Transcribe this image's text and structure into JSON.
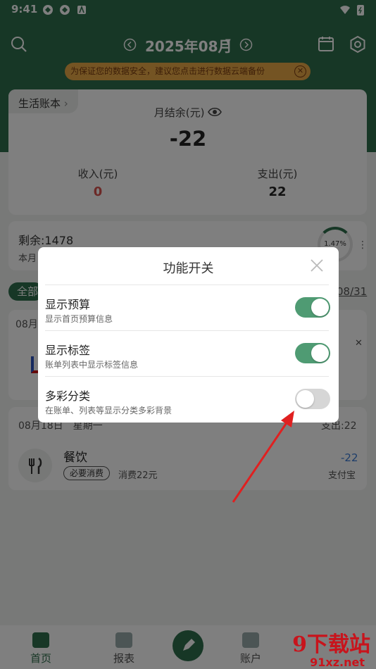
{
  "status_bar": {
    "time": "9:41"
  },
  "header": {
    "month": "2025年08月",
    "banner": "为保证您的数据安全，建议您点击进行数据云端备份"
  },
  "summary": {
    "book_name": "生活账本",
    "balance_label": "月结余(元)",
    "balance_value": "-22",
    "income_label": "收入(元)",
    "income_value": "0",
    "expense_label": "支出(元)",
    "expense_value": "22"
  },
  "budget": {
    "remain_label": "剩余:",
    "remain_value": "1478",
    "month_prefix": "本月",
    "percent": "1.47%"
  },
  "list": {
    "filter_all": "全部",
    "date_right": "08/31",
    "group_date_prefix": "08月",
    "record_date": "08月18日",
    "weekday": "星期一",
    "record_expense": "支出:22",
    "category": "餐饮",
    "tag": "必要消费",
    "note": "消费22元",
    "amount": "-22",
    "account": "支付宝"
  },
  "dialog": {
    "title": "功能开关",
    "rows": [
      {
        "title": "显示预算",
        "subtitle": "显示首页预算信息",
        "on": true
      },
      {
        "title": "显示标签",
        "subtitle": "账单列表中显示标签信息",
        "on": true
      },
      {
        "title": "多彩分类",
        "subtitle": "在账单、列表等显示分类多彩背景",
        "on": false
      }
    ]
  },
  "nav": {
    "home": "首页",
    "report": "报表",
    "account": "账户"
  },
  "watermark": {
    "brand": "9下载站",
    "url": "91xz.net"
  },
  "colors": {
    "accent": "#2f6e4d",
    "toggle_on": "#4f9b73",
    "income": "#d9534f",
    "annotation_arrow": "#e02020"
  }
}
